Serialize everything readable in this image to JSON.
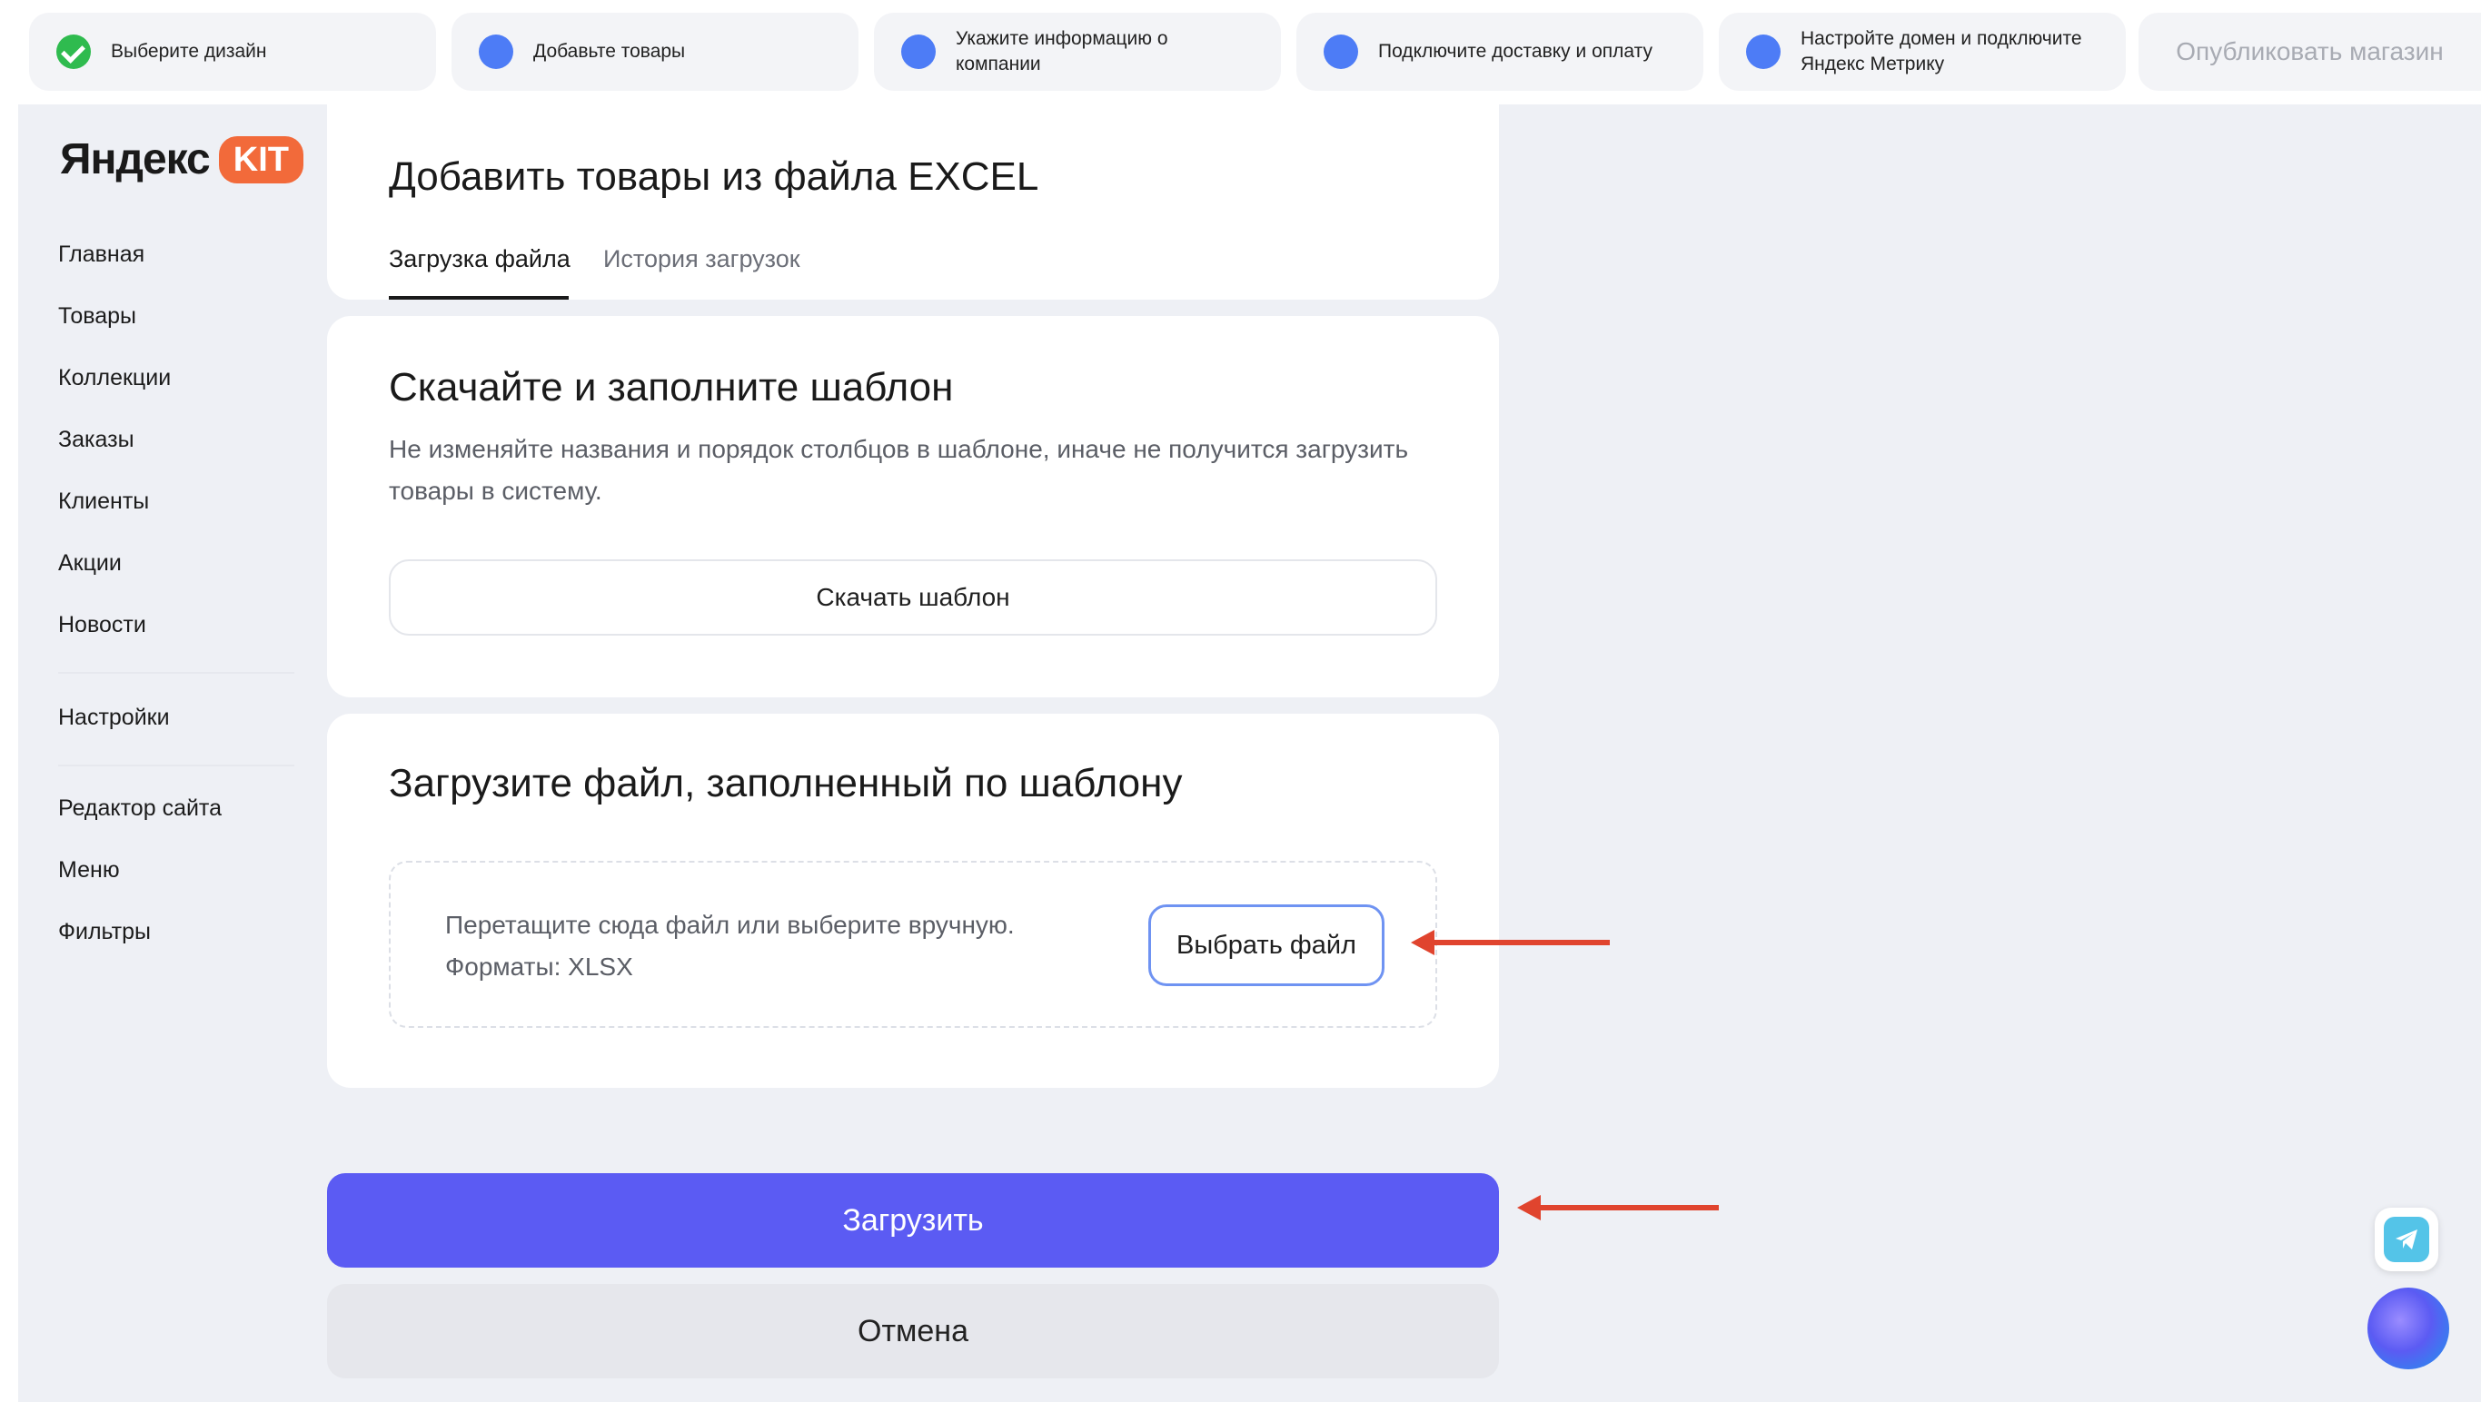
{
  "steps": [
    {
      "label": "Выберите дизайн",
      "state": "done"
    },
    {
      "label": "Добавьте товары",
      "state": "todo"
    },
    {
      "label": "Укажите информацию о компании",
      "state": "todo"
    },
    {
      "label": "Подключите доставку и оплату",
      "state": "todo"
    },
    {
      "label": "Настройте домен и подключите Яндекс Метрику",
      "state": "todo"
    }
  ],
  "publish_label": "Опубликовать магазин",
  "logo": {
    "word": "Яндекс",
    "badge": "KIT"
  },
  "sidebar": {
    "items": [
      "Главная",
      "Товары",
      "Коллекции",
      "Заказы",
      "Клиенты",
      "Акции",
      "Новости",
      "Настройки",
      "Редактор сайта",
      "Меню",
      "Фильтры"
    ]
  },
  "main": {
    "title": "Добавить товары из файла EXCEL",
    "tabs": [
      {
        "label": "Загрузка файла",
        "active": true
      },
      {
        "label": "История загрузок",
        "active": false
      }
    ],
    "template_card": {
      "heading": "Скачайте и заполните шаблон",
      "description": "Не изменяйте названия и порядок столбцов в шаблоне, иначе не получится загрузить товары в систему.",
      "button": "Скачать шаблон"
    },
    "upload_card": {
      "heading": "Загрузите файл, заполненный по шаблону",
      "drop_text": "Перетащите сюда файл или выберите вручную.",
      "formats": "Форматы: XLSX",
      "choose_button": "Выбрать файл"
    },
    "submit_label": "Загрузить",
    "cancel_label": "Отмена"
  },
  "colors": {
    "accent": "#5b5bf3",
    "step_dot": "#4d7cf6",
    "done": "#2fbb4f",
    "annotation_arrow": "#e0442e",
    "logo_badge": "#f26a3a"
  },
  "icons": [
    "check-icon",
    "telegram-icon",
    "assistant-orb-icon"
  ]
}
